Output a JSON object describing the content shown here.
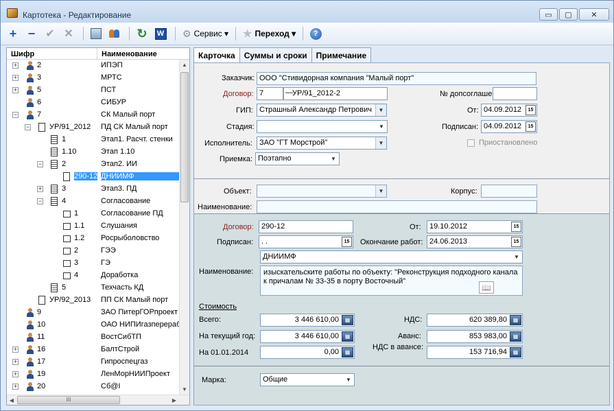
{
  "window": {
    "title": "Картотека - Редактирование",
    "buttons": [
      "▭",
      "▢",
      "✕"
    ]
  },
  "toolbar": {
    "add_label": "+",
    "remove_label": "−",
    "accept_label": "✔",
    "cancel_label": "✕",
    "word_label": "W",
    "help_label": "?",
    "refresh_label": "↻",
    "service_label": "Сервис ▾",
    "goto_label": "Переход ▾"
  },
  "tree": {
    "col_code": "Шифр",
    "col_name": "Наименование",
    "rows": [
      {
        "code": "2",
        "name": "ИПЭП"
      },
      {
        "code": "3",
        "name": "МРТС"
      },
      {
        "code": "5",
        "name": "ПСТ"
      },
      {
        "code": "6",
        "name": "СИБУР"
      },
      {
        "code": "7",
        "name": "СК Малый порт"
      },
      {
        "code": "УР/91_2012",
        "name": "ПД СК Малый порт"
      },
      {
        "code": "1",
        "name": "Этап1. Расчт. стенки"
      },
      {
        "code": "1.10",
        "name": "Этап 1.10"
      },
      {
        "code": "2",
        "name": "Этап2. ИИ"
      },
      {
        "code": "290-12",
        "name": "ДНИИМФ"
      },
      {
        "code": "3",
        "name": "Этап3. ПД"
      },
      {
        "code": "4",
        "name": "Согласование"
      },
      {
        "code": "1",
        "name": "Согласование ПД"
      },
      {
        "code": "1.1",
        "name": "Слушания"
      },
      {
        "code": "1.2",
        "name": "Росрыболовство"
      },
      {
        "code": "2",
        "name": "ГЭЭ"
      },
      {
        "code": "3",
        "name": "ГЭ"
      },
      {
        "code": "4",
        "name": "Доработка"
      },
      {
        "code": "5",
        "name": "Техчасть КД"
      },
      {
        "code": "УР/92_2013",
        "name": "ПП СК Малый порт"
      },
      {
        "code": "9",
        "name": "ЗАО ПитерГОРпроект"
      },
      {
        "code": "10",
        "name": "ОАО НИПИгазпереработ"
      },
      {
        "code": "11",
        "name": "ВостСибТП"
      },
      {
        "code": "16",
        "name": "БалтСтрой"
      },
      {
        "code": "17",
        "name": "Гипроспецгаз"
      },
      {
        "code": "19",
        "name": "ЛенМорНИИПроект"
      },
      {
        "code": "20",
        "name": "Сб@I"
      }
    ],
    "hscroll_label": "III"
  },
  "tabs": [
    "Карточка",
    "Суммы и сроки",
    "Примечание"
  ],
  "card": {
    "customer_label": "Заказчик:",
    "customer": "ООО \"Стивидорная компания \"Малый порт\"",
    "contract_label": "Договор:",
    "contract_num": "7",
    "contract_code": "УР/91_2012-2",
    "addendum_label": "№ допсоглашен",
    "gip_label": "ГИП:",
    "gip": "Страшный Александр Петрович",
    "from_label": "От:",
    "from_date": "04.09.2012",
    "stage_label": "Стадия:",
    "stage": "",
    "signed_label": "Подписан:",
    "signed_date": "04.09.2012",
    "executor_label": "Исполнитель:",
    "executor": "ЗАО \"ГТ Морстрой\"",
    "suspended_label": "Приостановлено",
    "acceptance_label": "Приемка:",
    "acceptance": "Поэтапно",
    "object_label": "Объект:",
    "object": "",
    "building_label": "Корпус:",
    "building": "",
    "name_label": "Наименование:",
    "name": ""
  },
  "subcontract": {
    "contract_label": "Договор:",
    "contract": "290-12",
    "from_label": "От:",
    "from_date": "19.10.2012",
    "signed_label": "Подписан:",
    "signed": " .  .",
    "end_label": "Окончание работ:",
    "end_date": "24.06.2013",
    "org": "ДНИИМФ",
    "name_label": "Наименование:",
    "name_line1": "изыскательските работы по объекту: \"Реконструкция подходного канала",
    "name_line2": "к причалам № 33-35 в порту Восточный\"",
    "cost_label": "Стоимость",
    "total_label": "Всего:",
    "total": "3 446 610,00",
    "current_label": "На текущий год:",
    "current": "3 446 610,00",
    "on_date_label": "На 01.01.2014",
    "on_date": "0,00",
    "vat_label": "НДС:",
    "vat": "620 389,80",
    "advance_label": "Аванс:",
    "advance": "853 983,00",
    "vat_adv_label": "НДС в авансе:",
    "vat_adv": "153 716,94",
    "mark_label": "Марка:",
    "mark": "Общие"
  }
}
